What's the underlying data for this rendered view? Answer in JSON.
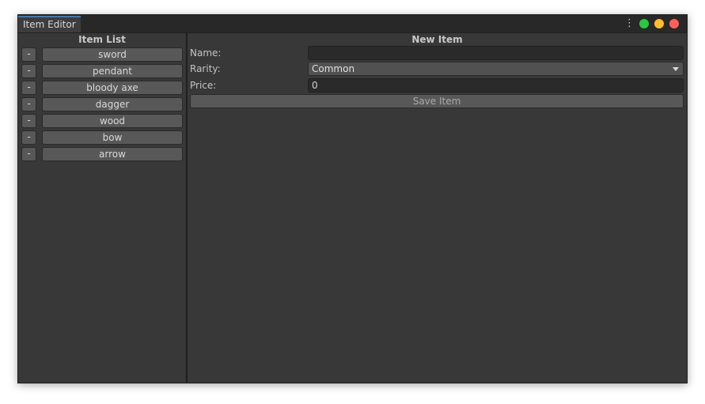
{
  "window": {
    "tab_title": "Item Editor",
    "menu_icon": "kebab-menu-icon",
    "controls": [
      "green-dot",
      "yellow-dot",
      "red-dot"
    ]
  },
  "item_list": {
    "title": "Item List",
    "remove_label": "-",
    "items": [
      "sword",
      "pendant",
      "bloody axe",
      "dagger",
      "wood",
      "bow",
      "arrow"
    ]
  },
  "new_item": {
    "title": "New Item",
    "name_label": "Name:",
    "name_value": "",
    "rarity_label": "Rarity:",
    "rarity_value": "Common",
    "price_label": "Price:",
    "price_value": "0",
    "save_label": "Save Item"
  },
  "colors": {
    "background": "#383838",
    "tab_accent": "#3a79bb",
    "button": "#585858",
    "input": "#2a2a2a"
  }
}
